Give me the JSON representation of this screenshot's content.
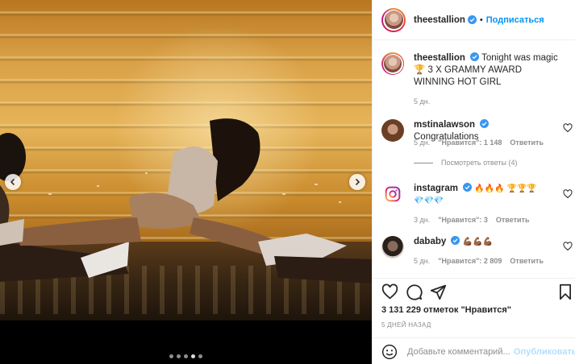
{
  "post": {
    "username": "theestallion",
    "follow_separator": "•",
    "follow_label": "Подписаться"
  },
  "caption": {
    "username": "theestallion",
    "text": "Tonight was magic 🏆 3 X GRAMMY AWARD WINNING HOT GIRL",
    "time": "5 дн."
  },
  "comments": [
    {
      "username": "mstinalawson",
      "text": "Congratulations",
      "time": "5 дн.",
      "likes": "\"Нравится\": 1 148",
      "reply": "Ответить",
      "view_replies": "Посмотреть ответы (4)"
    },
    {
      "username": "instagram",
      "text": "🔥🔥🔥 🏆🏆🏆 💎💎💎",
      "time": "3 дн.",
      "likes": "\"Нравится\": 3",
      "reply": "Ответить"
    },
    {
      "username": "dababy",
      "text": "💪🏾💪🏾💪🏾",
      "time": "5 дн.",
      "likes": "\"Нравится\": 2 809",
      "reply": "Ответить"
    }
  ],
  "actions": {
    "likes_text": "3 131 229 отметок \"Нравится\"",
    "post_date": "5 ДНЕЙ НАЗАД"
  },
  "add_comment": {
    "placeholder": "Добавьте комментарий...",
    "publish_label": "Опубликовать"
  },
  "carousel": {
    "total": 5,
    "current_index": 3
  },
  "colors": {
    "accent": "#0095f6",
    "verified": "#3897f0",
    "publish_disabled": "#b2dffc"
  }
}
